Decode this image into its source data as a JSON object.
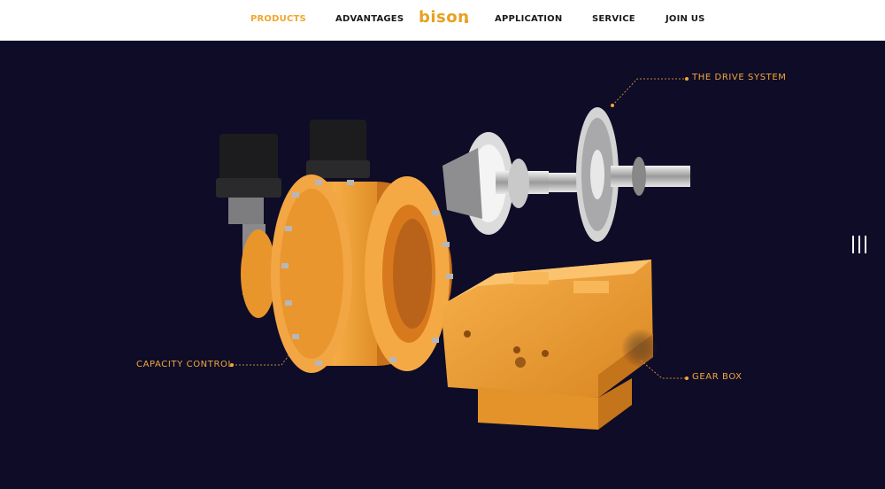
{
  "nav": {
    "items": [
      {
        "label": "PRODUCTS",
        "active": true
      },
      {
        "label": "ADVANTAGES",
        "active": false
      },
      {
        "label": "APPLICATION",
        "active": false
      },
      {
        "label": "SERVICE",
        "active": false
      },
      {
        "label": "JOIN US",
        "active": false
      }
    ],
    "logo_text": "bison"
  },
  "hero": {
    "callouts": {
      "drive_system": "THE DRIVE SYSTEM",
      "capacity_control": "CAPACITY CONTROL",
      "gear_box": "GEAR BOX"
    }
  },
  "colors": {
    "accent": "#f0a72e",
    "background": "#0e0c27",
    "header_bg": "#ffffff",
    "machine_orange": "#f2a33a"
  },
  "icons": {
    "menu": "vertical-bars-menu-icon"
  }
}
